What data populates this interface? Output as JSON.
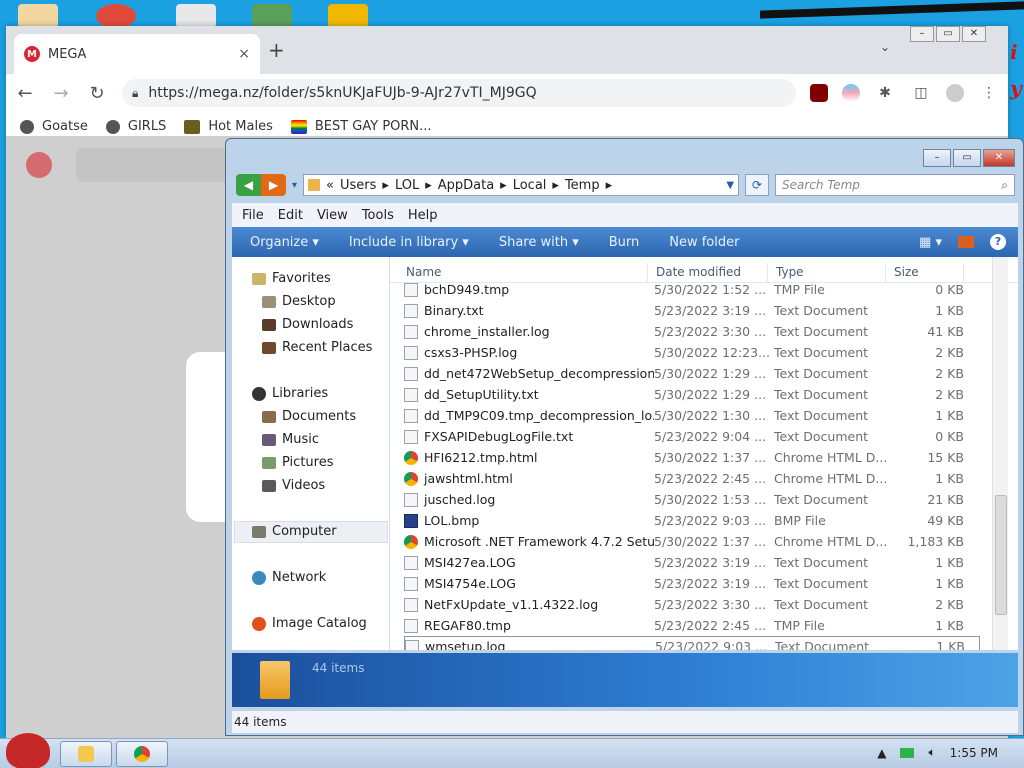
{
  "chrome": {
    "tab_title": "MEGA",
    "tab_close": "×",
    "new_tab": "+",
    "tab_dropdown": "⌄",
    "url": "https://mega.nz/folder/s5knUKJaFUJb-9-AJr27vTI_MJ9GQ",
    "bookmarks": [
      "Goatse",
      "GIRLS",
      "Hot Males",
      "BEST GAY PORN..."
    ]
  },
  "explorer": {
    "breadcrumb": [
      "«",
      "Users",
      "LOL",
      "AppData",
      "Local",
      "Temp"
    ],
    "search_placeholder": "Search Temp",
    "menu": [
      "File",
      "Edit",
      "View",
      "Tools",
      "Help"
    ],
    "commands": [
      "Organize ▾",
      "Include in library ▾",
      "Share with ▾",
      "Burn",
      "New folder"
    ],
    "nav": {
      "favorites": "Favorites",
      "desktop": "Desktop",
      "downloads": "Downloads",
      "recent": "Recent Places",
      "libraries": "Libraries",
      "documents": "Documents",
      "music": "Music",
      "pictures": "Pictures",
      "videos": "Videos",
      "computer": "Computer",
      "network": "Network",
      "image_catalog": "Image Catalog"
    },
    "columns": [
      "Name",
      "Date modified",
      "Type",
      "Size"
    ],
    "files": [
      {
        "name": "bchD949.tmp",
        "date": "5/30/2022 1:52 ...",
        "type": "TMP File",
        "size": "0 KB",
        "icon": "file-icon"
      },
      {
        "name": "Binary.txt",
        "date": "5/23/2022 3:19 ...",
        "type": "Text Document",
        "size": "1 KB",
        "icon": "file-icon"
      },
      {
        "name": "chrome_installer.log",
        "date": "5/23/2022 3:30 ...",
        "type": "Text Document",
        "size": "41 KB",
        "icon": "file-icon"
      },
      {
        "name": "csxs3-PHSP.log",
        "date": "5/30/2022 12:23...",
        "type": "Text Document",
        "size": "2 KB",
        "icon": "file-icon"
      },
      {
        "name": "dd_net472WebSetup_decompression...",
        "date": "5/30/2022 1:29 ...",
        "type": "Text Document",
        "size": "2 KB",
        "icon": "file-icon"
      },
      {
        "name": "dd_SetupUtility.txt",
        "date": "5/30/2022 1:29 ...",
        "type": "Text Document",
        "size": "2 KB",
        "icon": "file-icon"
      },
      {
        "name": "dd_TMP9C09.tmp_decompression_lo...",
        "date": "5/30/2022 1:30 ...",
        "type": "Text Document",
        "size": "1 KB",
        "icon": "file-icon"
      },
      {
        "name": "FXSAPIDebugLogFile.txt",
        "date": "5/23/2022 9:04 ...",
        "type": "Text Document",
        "size": "0 KB",
        "icon": "file-icon"
      },
      {
        "name": "HFI6212.tmp.html",
        "date": "5/30/2022 1:37 ...",
        "type": "Chrome HTML D...",
        "size": "15 KB",
        "icon": "chrome-icon"
      },
      {
        "name": "jawshtml.html",
        "date": "5/23/2022 2:45 ...",
        "type": "Chrome HTML D...",
        "size": "1 KB",
        "icon": "chrome-icon"
      },
      {
        "name": "jusched.log",
        "date": "5/30/2022 1:53 ...",
        "type": "Text Document",
        "size": "21 KB",
        "icon": "file-icon"
      },
      {
        "name": "LOL.bmp",
        "date": "5/23/2022 9:03 ...",
        "type": "BMP File",
        "size": "49 KB",
        "icon": "bmp-icon"
      },
      {
        "name": "Microsoft .NET Framework 4.7.2 Setu...",
        "date": "5/30/2022 1:37 ...",
        "type": "Chrome HTML D...",
        "size": "1,183 KB",
        "icon": "chrome-icon"
      },
      {
        "name": "MSI427ea.LOG",
        "date": "5/23/2022 3:19 ...",
        "type": "Text Document",
        "size": "1 KB",
        "icon": "file-icon"
      },
      {
        "name": "MSI4754e.LOG",
        "date": "5/23/2022 3:19 ...",
        "type": "Text Document",
        "size": "1 KB",
        "icon": "file-icon"
      },
      {
        "name": "NetFxUpdate_v1.1.4322.log",
        "date": "5/23/2022 3:30 ...",
        "type": "Text Document",
        "size": "2 KB",
        "icon": "file-icon"
      },
      {
        "name": "REGAF80.tmp",
        "date": "5/23/2022 2:45 ...",
        "type": "TMP File",
        "size": "1 KB",
        "icon": "file-icon"
      },
      {
        "name": "wmsetup.log",
        "date": "5/23/2022 9:03 ...",
        "type": "Text Document",
        "size": "1 KB",
        "icon": "file-icon"
      }
    ],
    "details_count": "44 items",
    "status": "44 items"
  },
  "taskbar": {
    "clock": "1:55 PM"
  }
}
